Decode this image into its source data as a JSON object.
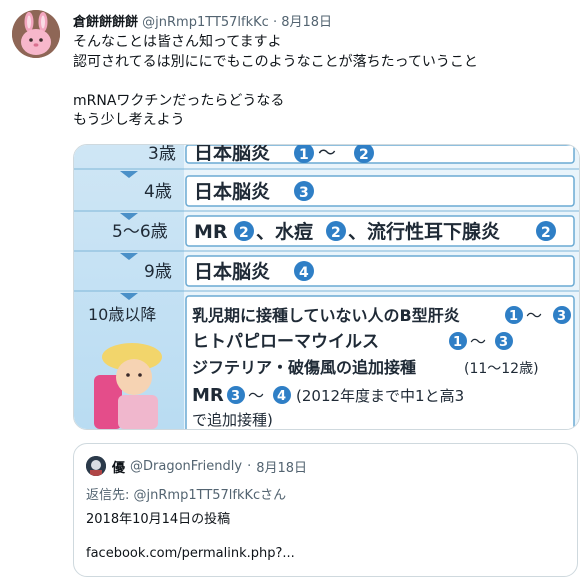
{
  "tweet": {
    "display_name": "倉餅餅餅餅",
    "handle": "@jnRmp1TT57lfkKc",
    "separator": "·",
    "date": "8月18日",
    "lines": [
      "そんなことは皆さん知ってますよ",
      "認可されてるは別ににでもこのようなことが落ちたっていうこと",
      "",
      "mRNAワクチンだったらどうなる",
      "もう少し考えよう"
    ]
  },
  "media": {
    "rows": [
      {
        "age": "3歳",
        "text": "日本脳炎",
        "marks": [
          "1",
          "2"
        ],
        "joiner": "〜"
      },
      {
        "age": "4歳",
        "text": "日本脳炎",
        "marks": [
          "3"
        ],
        "joiner": ""
      },
      {
        "age": "5〜6歳",
        "text": "MR",
        "extra": "、水痘",
        "tail": "、流行性耳下腺炎",
        "marks": [
          "2",
          "2",
          "2"
        ]
      },
      {
        "age": "9歳",
        "text": "日本脳炎",
        "marks": [
          "4"
        ],
        "joiner": ""
      }
    ],
    "last_age": "10歳以降",
    "last_lines": [
      "乳児期に接種していない人のB型肝炎",
      "ヒトパピローマウイルス",
      "ジフテリア・破傷風の追加接種",
      "(11〜12歳)",
      "MR",
      "(2012年度まで中1と高3",
      "で追加接種)"
    ]
  },
  "quote": {
    "display_name": "優",
    "handle": "@DragonFriendly",
    "separator": "·",
    "date": "8月18日",
    "reply_prefix": "返信先:",
    "reply_to": "@jnRmp1TT57lfkKcさん",
    "text": "2018年10月14日の投稿",
    "link": "facebook.com/permalink.php?..."
  }
}
